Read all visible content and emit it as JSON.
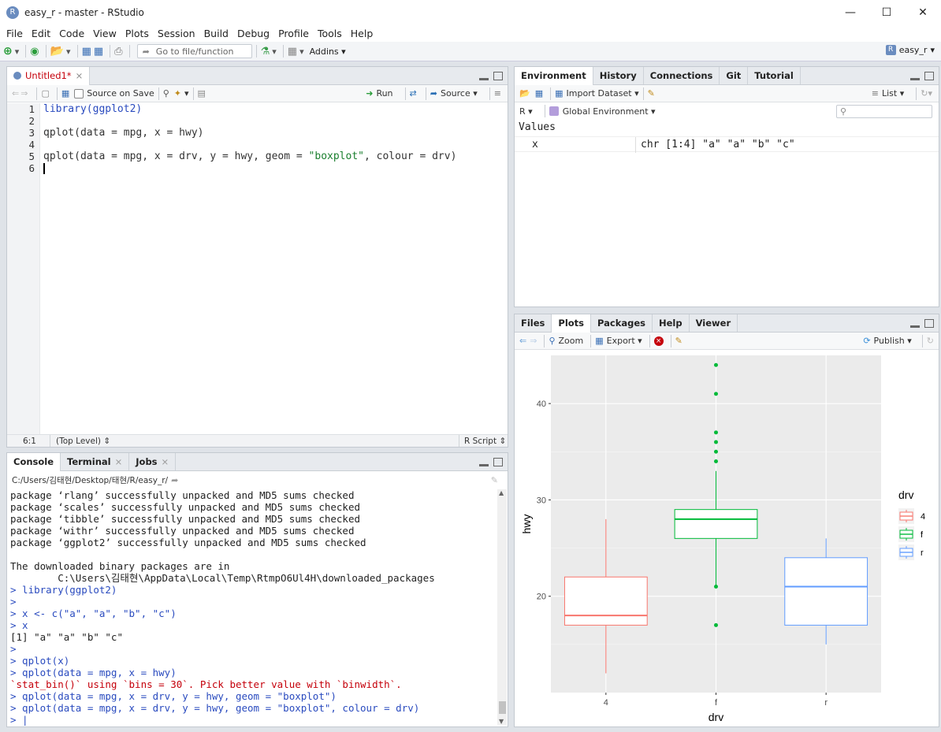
{
  "window": {
    "title": "easy_r - master - RStudio",
    "app_icon": "R"
  },
  "menu": [
    "File",
    "Edit",
    "Code",
    "View",
    "Plots",
    "Session",
    "Build",
    "Debug",
    "Profile",
    "Tools",
    "Help"
  ],
  "toolbar": {
    "goto_placeholder": "Go to file/function",
    "addins_label": "Addins",
    "project_label": "easy_r"
  },
  "editor": {
    "tab_label": "Untitled1*",
    "source_on_save_label": "Source on Save",
    "run_label": "Run",
    "source_label": "Source",
    "line_numbers": [
      "1",
      "2",
      "3",
      "4",
      "5",
      "6"
    ],
    "lines": {
      "l1": "library(ggplot2)",
      "l3": "qplot(data = mpg, x = hwy)",
      "l5a": "qplot(data = mpg, x = drv, y = hwy, geom = ",
      "l5b": "\"boxplot\"",
      "l5c": ", colour = drv)"
    },
    "status": {
      "position": "6:1",
      "scope": "(Top Level)",
      "file_type": "R Script"
    }
  },
  "console": {
    "tabs": [
      "Console",
      "Terminal",
      "Jobs"
    ],
    "path": "C:/Users/김태현/Desktop/태현/R/easy_r/",
    "lines": [
      {
        "text": "package ‘rlang’ successfully unpacked and MD5 sums checked",
        "kind": "out"
      },
      {
        "text": "package ‘scales’ successfully unpacked and MD5 sums checked",
        "kind": "out"
      },
      {
        "text": "package ‘tibble’ successfully unpacked and MD5 sums checked",
        "kind": "out"
      },
      {
        "text": "package ‘withr’ successfully unpacked and MD5 sums checked",
        "kind": "out"
      },
      {
        "text": "package ‘ggplot2’ successfully unpacked and MD5 sums checked",
        "kind": "out"
      },
      {
        "text": "",
        "kind": "out"
      },
      {
        "text": "The downloaded binary packages are in",
        "kind": "out"
      },
      {
        "text": "        C:\\Users\\김태현\\AppData\\Local\\Temp\\RtmpO6Ul4H\\downloaded_packages",
        "kind": "out"
      },
      {
        "text": "> library(ggplot2)",
        "kind": "prompt"
      },
      {
        "text": ">",
        "kind": "prompt"
      },
      {
        "text": "> x <- c(\"a\", \"a\", \"b\", \"c\")",
        "kind": "prompt"
      },
      {
        "text": "> x",
        "kind": "prompt"
      },
      {
        "text": "[1] \"a\" \"a\" \"b\" \"c\"",
        "kind": "out"
      },
      {
        "text": ">",
        "kind": "prompt"
      },
      {
        "text": "> qplot(x)",
        "kind": "prompt"
      },
      {
        "text": "> qplot(data = mpg, x = hwy)",
        "kind": "prompt"
      },
      {
        "text": "`stat_bin()` using `bins = 30`. Pick better value with `binwidth`.",
        "kind": "err"
      },
      {
        "text": "> qplot(data = mpg, x = drv, y = hwy, geom = \"boxplot\")",
        "kind": "prompt"
      },
      {
        "text": "> qplot(data = mpg, x = drv, y = hwy, geom = \"boxplot\", colour = drv)",
        "kind": "prompt"
      },
      {
        "text": "> |",
        "kind": "prompt"
      }
    ]
  },
  "environment": {
    "tabs": [
      "Environment",
      "History",
      "Connections",
      "Git",
      "Tutorial"
    ],
    "import_label": "Import Dataset",
    "list_label": "List",
    "lang_label": "R",
    "scope_label": "Global Environment",
    "section": "Values",
    "rows": [
      {
        "name": "x",
        "value": "chr [1:4] \"a\" \"a\" \"b\" \"c\""
      }
    ]
  },
  "files_pane": {
    "tabs": [
      "Files",
      "Plots",
      "Packages",
      "Help",
      "Viewer"
    ],
    "zoom_label": "Zoom",
    "export_label": "Export",
    "publish_label": "Publish"
  },
  "chart_data": {
    "type": "boxplot",
    "xlabel": "drv",
    "ylabel": "hwy",
    "categories": [
      "4",
      "f",
      "r"
    ],
    "ylim": [
      10,
      45
    ],
    "yticks": [
      20,
      30,
      40
    ],
    "grid": true,
    "legend": {
      "title": "drv",
      "position": "right",
      "entries": [
        "4",
        "f",
        "r"
      ]
    },
    "colors": {
      "4": "#F8766D",
      "f": "#00BA38",
      "r": "#619CFF"
    },
    "boxes": [
      {
        "category": "4",
        "min": 12,
        "q1": 17,
        "median": 18,
        "q3": 22,
        "max": 28,
        "outliers": []
      },
      {
        "category": "f",
        "min": 21,
        "q1": 26,
        "median": 28,
        "q3": 29,
        "max": 33,
        "outliers": [
          17,
          21,
          34,
          35,
          36,
          37,
          41,
          44
        ]
      },
      {
        "category": "r",
        "min": 15,
        "q1": 17,
        "median": 21,
        "q3": 24,
        "max": 26,
        "outliers": []
      }
    ]
  }
}
